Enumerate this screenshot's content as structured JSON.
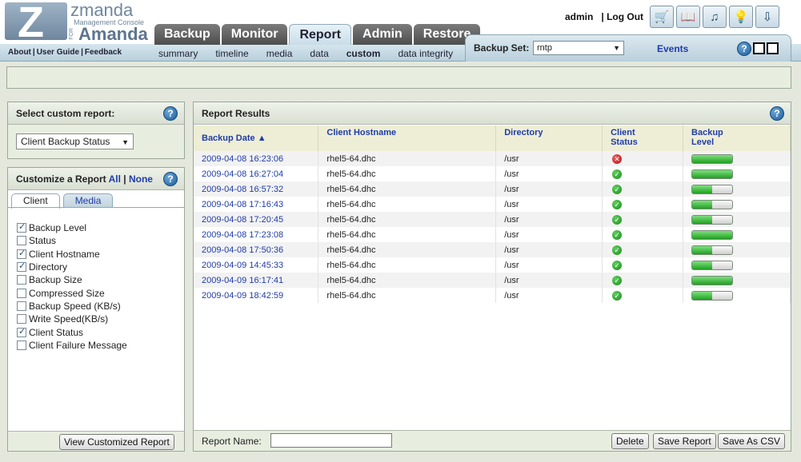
{
  "logo": {
    "title": "zmanda",
    "subtitle": "Management Console",
    "for": "FOR",
    "product": "Amanda"
  },
  "main_tabs": [
    {
      "label": "Backup",
      "active": false
    },
    {
      "label": "Monitor",
      "active": false
    },
    {
      "label": "Report",
      "active": true
    },
    {
      "label": "Admin",
      "active": false
    },
    {
      "label": "Restore",
      "active": false
    }
  ],
  "top_links": {
    "about": "About",
    "guide": "User Guide",
    "feedback": "Feedback",
    "sep": "|"
  },
  "subnav": [
    "summary",
    "timeline",
    "media",
    "data",
    "custom",
    "data integrity"
  ],
  "subnav_active": "custom",
  "user": {
    "name": "admin",
    "sep": "|",
    "logout": "Log Out"
  },
  "toolbar_icons": [
    "cart-icon",
    "book-icon",
    "music-icon",
    "lightbulb-icon",
    "download-arrow-icon"
  ],
  "backup_set": {
    "label": "Backup Set:",
    "value": "rntp",
    "events": "Events"
  },
  "help_glyph": "?",
  "custom_select": {
    "title": "Select custom report:",
    "value": "Client Backup Status"
  },
  "customize": {
    "title": "Customize a Report",
    "all": "All",
    "sep": "|",
    "none": "None",
    "tabs": [
      "Client",
      "Media"
    ],
    "fields": [
      {
        "label": "Backup Level",
        "checked": true
      },
      {
        "label": "Status",
        "checked": false
      },
      {
        "label": "Client Hostname",
        "checked": true
      },
      {
        "label": "Directory",
        "checked": true
      },
      {
        "label": "Backup Size",
        "checked": false
      },
      {
        "label": "Compressed Size",
        "checked": false
      },
      {
        "label": "Backup Speed (KB/s)",
        "checked": false
      },
      {
        "label": "Write Speed(KB/s)",
        "checked": false
      },
      {
        "label": "Client Status",
        "checked": true
      },
      {
        "label": "Client Failure Message",
        "checked": false
      }
    ],
    "view_button": "View Customized Report"
  },
  "results": {
    "title": "Report Results",
    "columns": [
      "Backup Date",
      "Client Hostname",
      "Directory",
      "Client Status",
      "Backup Level"
    ],
    "sort_glyph": "▲",
    "rows": [
      {
        "date": "2009-04-08 16:23:06",
        "host": "rhel5-64.dhc",
        "dir": "/usr",
        "status": "error",
        "level": 1.0
      },
      {
        "date": "2009-04-08 16:27:04",
        "host": "rhel5-64.dhc",
        "dir": "/usr",
        "status": "ok",
        "level": 1.0
      },
      {
        "date": "2009-04-08 16:57:32",
        "host": "rhel5-64.dhc",
        "dir": "/usr",
        "status": "ok",
        "level": 0.5
      },
      {
        "date": "2009-04-08 17:16:43",
        "host": "rhel5-64.dhc",
        "dir": "/usr",
        "status": "ok",
        "level": 0.5
      },
      {
        "date": "2009-04-08 17:20:45",
        "host": "rhel5-64.dhc",
        "dir": "/usr",
        "status": "ok",
        "level": 0.5
      },
      {
        "date": "2009-04-08 17:23:08",
        "host": "rhel5-64.dhc",
        "dir": "/usr",
        "status": "ok",
        "level": 1.0
      },
      {
        "date": "2009-04-08 17:50:36",
        "host": "rhel5-64.dhc",
        "dir": "/usr",
        "status": "ok",
        "level": 0.5
      },
      {
        "date": "2009-04-09 14:45:33",
        "host": "rhel5-64.dhc",
        "dir": "/usr",
        "status": "ok",
        "level": 0.5
      },
      {
        "date": "2009-04-09 16:17:41",
        "host": "rhel5-64.dhc",
        "dir": "/usr",
        "status": "ok",
        "level": 1.0
      },
      {
        "date": "2009-04-09 18:42:59",
        "host": "rhel5-64.dhc",
        "dir": "/usr",
        "status": "ok",
        "level": 0.5
      }
    ],
    "report_name_label": "Report Name:",
    "delete_button": "Delete",
    "save_button": "Save Report",
    "csv_button": "Save As CSV"
  }
}
